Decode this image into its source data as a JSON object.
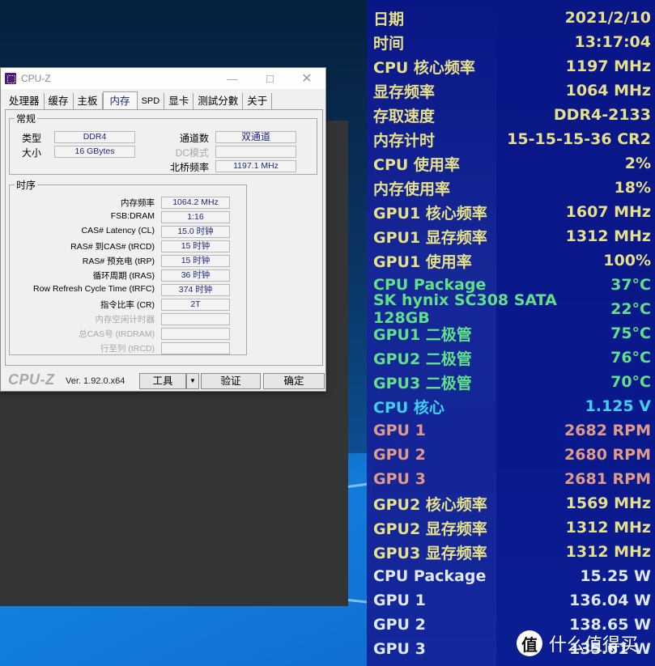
{
  "cpuz": {
    "title": "CPU-Z",
    "window_controls": {
      "minimize": "—",
      "maximize": "",
      "close": "✕"
    },
    "tabs": [
      {
        "label": "处理器",
        "active": false
      },
      {
        "label": "缓存",
        "active": false
      },
      {
        "label": "主板",
        "active": false
      },
      {
        "label": "内存",
        "active": true
      },
      {
        "label": "SPD",
        "active": false
      },
      {
        "label": "显卡",
        "active": false
      },
      {
        "label": "测試分數",
        "active": false
      },
      {
        "label": "关于",
        "active": false
      }
    ],
    "general": {
      "legend": "常规",
      "type_label": "类型",
      "type_value": "DDR4",
      "size_label": "大小",
      "size_value": "16 GBytes",
      "channels_label": "通道数",
      "channels_value": "双通道",
      "dc_mode_label": "DC模式",
      "dc_mode_value": "",
      "nb_freq_label": "北桥频率",
      "nb_freq_value": "1197.1 MHz"
    },
    "timing": {
      "legend": "时序",
      "rows": [
        {
          "label": "内存频率",
          "value": "1064.2 MHz",
          "disabled": false
        },
        {
          "label": "FSB:DRAM",
          "value": "1:16",
          "disabled": false
        },
        {
          "label": "CAS# Latency (CL)",
          "value": "15.0 时钟",
          "disabled": false
        },
        {
          "label": "RAS# 到CAS# (tRCD)",
          "value": "15 时钟",
          "disabled": false
        },
        {
          "label": "RAS# 预充电 (tRP)",
          "value": "15 时钟",
          "disabled": false
        },
        {
          "label": "循环周期 (tRAS)",
          "value": "36 时钟",
          "disabled": false
        },
        {
          "label": "Row Refresh Cycle Time (tRFC)",
          "value": "374 时钟",
          "disabled": false
        },
        {
          "label": "指令比率 (CR)",
          "value": "2T",
          "disabled": false
        },
        {
          "label": "内存空闲计时器",
          "value": "",
          "disabled": true
        },
        {
          "label": "总CAS号 (tRDRAM)",
          "value": "",
          "disabled": true
        },
        {
          "label": "行至列 (tRCD)",
          "value": "",
          "disabled": true
        }
      ]
    },
    "bottom": {
      "brand": "CPU-Z",
      "version": "Ver. 1.92.0.x64",
      "tools_label": "工具",
      "tools_dropdown": "▼",
      "validate_label": "验证",
      "ok_label": "确定"
    }
  },
  "osd": {
    "colors": {
      "yellow": "#e6e08a",
      "green": "#5fe08a",
      "cyan": "#3fd0f0",
      "salmon": "#e09a8a",
      "white": "#dfe8ff"
    },
    "rows": [
      {
        "label": "日期",
        "value": "2021/2/10",
        "color": "yellow"
      },
      {
        "label": "时间",
        "value": "13:17:04",
        "color": "yellow"
      },
      {
        "label": "CPU 核心频率",
        "value": "1197 MHz",
        "color": "yellow"
      },
      {
        "label": "显存频率",
        "value": "1064 MHz",
        "color": "yellow"
      },
      {
        "label": "存取速度",
        "value": "DDR4-2133",
        "color": "yellow"
      },
      {
        "label": "内存计时",
        "value": "15-15-15-36 CR2",
        "color": "yellow"
      },
      {
        "label": "CPU 使用率",
        "value": "2%",
        "color": "yellow"
      },
      {
        "label": "内存使用率",
        "value": "18%",
        "color": "yellow"
      },
      {
        "label": "GPU1 核心频率",
        "value": "1607 MHz",
        "color": "yellow"
      },
      {
        "label": "GPU1 显存频率",
        "value": "1312 MHz",
        "color": "yellow"
      },
      {
        "label": "GPU1 使用率",
        "value": "100%",
        "color": "yellow"
      },
      {
        "label": "CPU Package",
        "value": "37°C",
        "color": "green"
      },
      {
        "label": "SK hynix SC308 SATA 128GB",
        "value": "22°C",
        "color": "green"
      },
      {
        "label": "GPU1 二极管",
        "value": "75°C",
        "color": "green"
      },
      {
        "label": "GPU2 二极管",
        "value": "76°C",
        "color": "green"
      },
      {
        "label": "GPU3 二极管",
        "value": "70°C",
        "color": "green"
      },
      {
        "label": "CPU 核心",
        "value": "1.125 V",
        "color": "cyan"
      },
      {
        "label": "GPU 1",
        "value": "2682 RPM",
        "color": "salmon"
      },
      {
        "label": "GPU 2",
        "value": "2680 RPM",
        "color": "salmon"
      },
      {
        "label": "GPU 3",
        "value": "2681 RPM",
        "color": "salmon"
      },
      {
        "label": "GPU2 核心频率",
        "value": "1569 MHz",
        "color": "yellow"
      },
      {
        "label": "GPU2 显存频率",
        "value": "1312 MHz",
        "color": "yellow"
      },
      {
        "label": "GPU3 显存频率",
        "value": "1312 MHz",
        "color": "yellow"
      },
      {
        "label": "CPU Package",
        "value": "15.25 W",
        "color": "white"
      },
      {
        "label": "GPU 1",
        "value": "136.04 W",
        "color": "white"
      },
      {
        "label": "GPU 2",
        "value": "138.65 W",
        "color": "white"
      },
      {
        "label": "GPU 3",
        "value": "135.61 W",
        "color": "white"
      }
    ]
  },
  "watermark": {
    "badge": "值",
    "text": "什么值得买"
  }
}
